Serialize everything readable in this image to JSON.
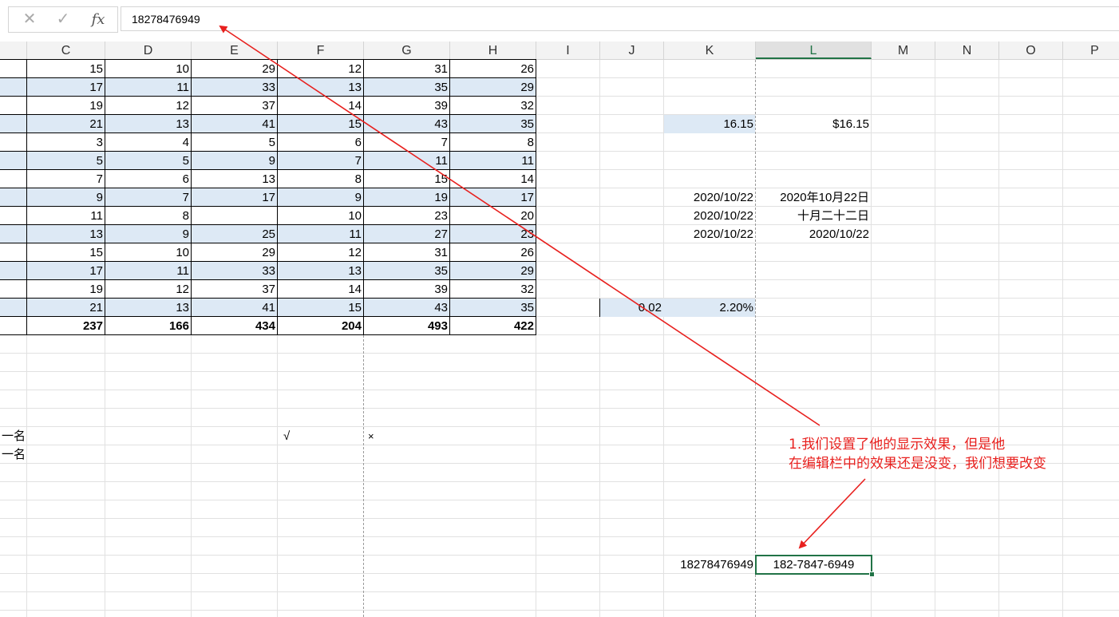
{
  "formula_bar": {
    "cancel_icon": "close-icon",
    "enter_icon": "check-icon",
    "fx_label": "fx",
    "value": "18278476949"
  },
  "columns": [
    "C",
    "D",
    "E",
    "F",
    "G",
    "H",
    "I",
    "J",
    "K",
    "L",
    "M",
    "N",
    "O",
    "P"
  ],
  "selected_column": "L",
  "table": {
    "columns": [
      "C",
      "D",
      "E",
      "F",
      "G",
      "H"
    ],
    "rows": [
      [
        "15",
        "10",
        "29",
        "12",
        "31",
        "26"
      ],
      [
        "17",
        "11",
        "33",
        "13",
        "35",
        "29"
      ],
      [
        "19",
        "12",
        "37",
        "14",
        "39",
        "32"
      ],
      [
        "21",
        "13",
        "41",
        "15",
        "43",
        "35"
      ],
      [
        "3",
        "4",
        "5",
        "6",
        "7",
        "8"
      ],
      [
        "5",
        "5",
        "9",
        "7",
        "11",
        "11"
      ],
      [
        "7",
        "6",
        "13",
        "8",
        "15",
        "14"
      ],
      [
        "9",
        "7",
        "17",
        "9",
        "19",
        "17"
      ],
      [
        "11",
        "8",
        "",
        "10",
        "23",
        "20"
      ],
      [
        "13",
        "9",
        "25",
        "11",
        "27",
        "23"
      ],
      [
        "15",
        "10",
        "29",
        "12",
        "31",
        "26"
      ],
      [
        "17",
        "11",
        "33",
        "13",
        "35",
        "29"
      ],
      [
        "19",
        "12",
        "37",
        "14",
        "39",
        "32"
      ],
      [
        "21",
        "13",
        "41",
        "15",
        "43",
        "35"
      ]
    ],
    "totals": [
      "237",
      "166",
      "434",
      "204",
      "493",
      "422"
    ]
  },
  "side_cells": {
    "k4": "16.15",
    "l4": "$16.15",
    "k8": "2020/10/22",
    "l8": "2020年10月22日",
    "k9": "2020/10/22",
    "l9": "十月二十二日",
    "k10": "2020/10/22",
    "l10": "2020/10/22",
    "j14": "0.02",
    "k14": "2.20%",
    "k28": "18278476949",
    "l28": "182-7847-6949"
  },
  "left_text": [
    "一名",
    "一名"
  ],
  "check_mark": "√",
  "cross_mark": "×",
  "annotation": {
    "line1": "1.我们设置了他的显示效果，但是他",
    "line2": "在编辑栏中的效果还是没变，我们想要改变"
  },
  "colors": {
    "band": "#dde9f5",
    "selection": "#217346",
    "annotation": "#e8201e"
  }
}
